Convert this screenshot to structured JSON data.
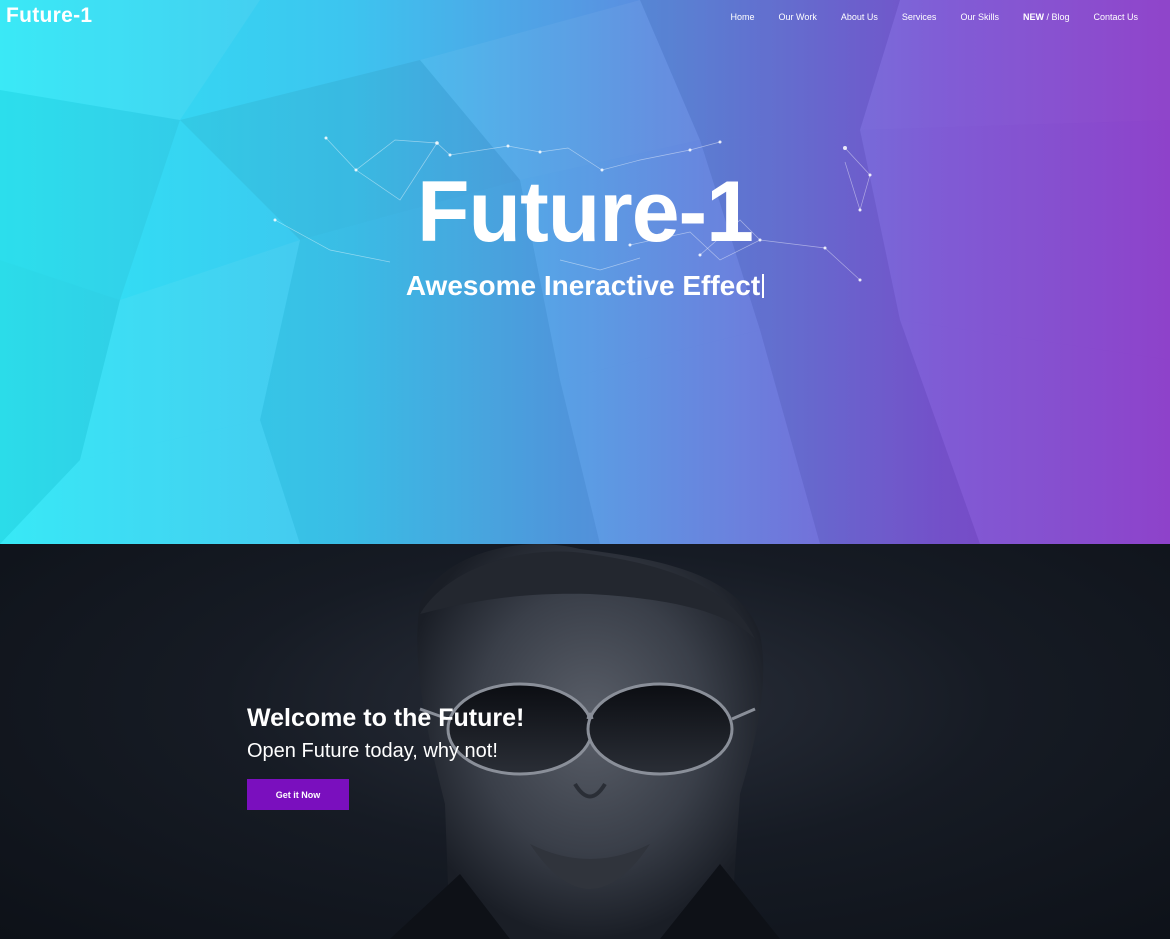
{
  "header": {
    "logo": "Future-1",
    "nav": [
      {
        "label": "Home"
      },
      {
        "label": "Our Work"
      },
      {
        "label": "About Us"
      },
      {
        "label": "Services"
      },
      {
        "label": "Our Skills"
      },
      {
        "badge": "NEW",
        "label": " / Blog"
      },
      {
        "label": "Contact Us"
      }
    ]
  },
  "hero": {
    "title": "Future-1",
    "subtitle": "Awesome Ineractive Effect"
  },
  "intro": {
    "heading": "Welcome to the Future!",
    "tagline": "Open Future today, why not!",
    "cta_label": "Get it Now"
  },
  "colors": {
    "gradient_start": "#2ee8f6",
    "gradient_end": "#8a3bc8",
    "cta": "#7a0fbe",
    "dark_section": "#111620"
  }
}
